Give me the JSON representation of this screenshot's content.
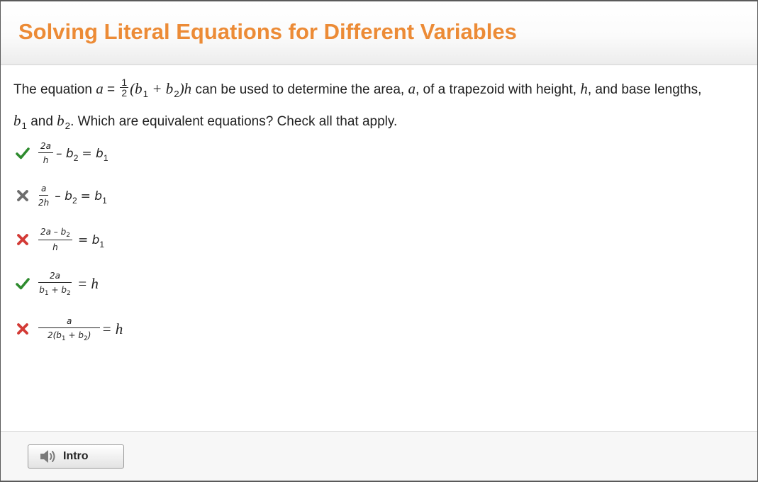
{
  "header": {
    "title": "Solving Literal Equations for Different Variables"
  },
  "question": {
    "p1": "The equation",
    "var_a": "a",
    "equals": "=",
    "half_num": "1",
    "half_den": "2",
    "open_b": "(b",
    "sub1": "1",
    "plus_b": "+ b",
    "sub2": "2",
    "close_h": ")h",
    "p2": "can be used to determine the area,",
    "var_a2": "a",
    "p3": ", of a trapezoid with height,",
    "var_h": "h",
    "p4": ", and base lengths,",
    "b": "b",
    "s1": "1",
    "p5": "and",
    "b2": "b",
    "s2": "2",
    "p6": ". Which are equivalent equations? Check all that apply."
  },
  "options": [
    {
      "status": "correct",
      "num": "2a",
      "den": "h",
      "rest": "– b",
      "rest_sub": "2",
      "rhs": "= b",
      "rhs_sub": "1"
    },
    {
      "status": "neutral",
      "num": "a",
      "den": "2h",
      "rest": "– b",
      "rest_sub": "2",
      "rhs": "= b",
      "rhs_sub": "1"
    },
    {
      "status": "wrong",
      "num": "2a – b",
      "num_sub": "2",
      "den": "h",
      "rhs": "= b",
      "rhs_sub": "1"
    },
    {
      "status": "correct",
      "num": "2a",
      "den": "b",
      "den_sub1": "1",
      "den_mid": " + b",
      "den_sub2": "2",
      "rhs": "= h"
    },
    {
      "status": "wrong",
      "num": "a",
      "den": "2(b",
      "den_sub1": "1",
      "den_mid": " + b",
      "den_sub2": "2",
      "den_end": ")",
      "rhs": "= h"
    }
  ],
  "footer": {
    "intro_label": "Intro",
    "intro_icon": "speaker-icon"
  },
  "colors": {
    "title": "#ec8b36",
    "correct": "#2e8b2e",
    "wrong": "#d33b36",
    "neutral": "#6e6e6e"
  }
}
